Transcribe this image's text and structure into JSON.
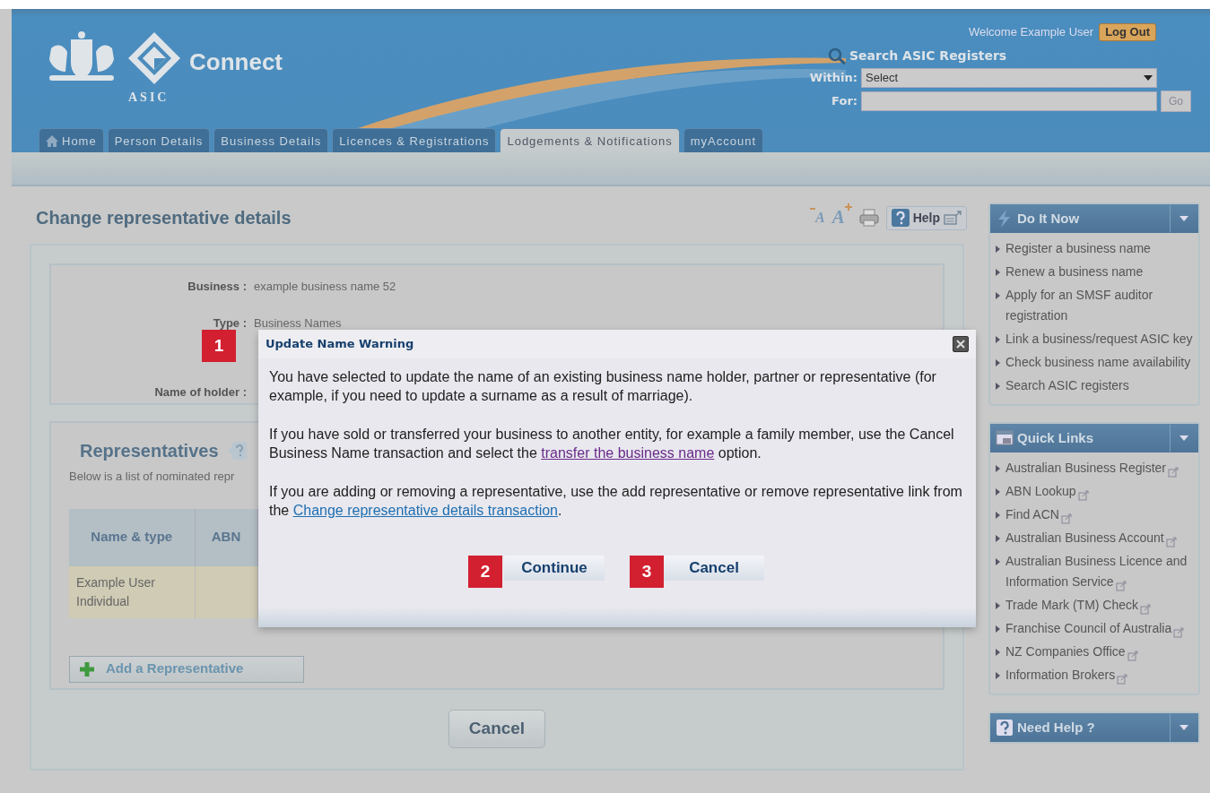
{
  "header": {
    "brand": "Connect",
    "org": "ASIC",
    "welcome": "Welcome Example User",
    "logout": "Log Out",
    "search": {
      "title": "Search ASIC Registers",
      "within_label": "Within:",
      "within_value": "Select",
      "for_label": "For:",
      "go": "Go"
    }
  },
  "tabs": [
    {
      "label": "Home",
      "kind": "home",
      "selected": false
    },
    {
      "label": "Person Details",
      "kind": "text",
      "selected": false
    },
    {
      "label": "Business Details",
      "kind": "text",
      "selected": false
    },
    {
      "label": "Licences & Registrations",
      "kind": "text",
      "selected": false
    },
    {
      "label": "Lodgements & Notifications",
      "kind": "text",
      "selected": true
    },
    {
      "label": "myAccount",
      "kind": "text",
      "selected": false
    }
  ],
  "page_title": "Change representative details",
  "toolbar": {
    "text_size": [
      {
        "label": "A",
        "kind": "decrease"
      },
      {
        "label": "A",
        "kind": "increase"
      }
    ],
    "help": "Help"
  },
  "details": [
    {
      "label": "Business :",
      "value": "example business name 52"
    },
    {
      "label": "Type :",
      "value": "Business Names"
    },
    {
      "label": "Name of holder :"
    }
  ],
  "representatives": {
    "title": "Representatives",
    "intro": "Below is a list of nominated repr",
    "columns": [
      "Name & type",
      "ABN"
    ],
    "rows": [
      {
        "cells": [
          [
            "Example User",
            "Individual"
          ],
          []
        ]
      }
    ],
    "add": "Add a Representative"
  },
  "cancel": "Cancel",
  "sidebar": [
    {
      "title": "Do It Now",
      "kind": "bolt",
      "items": [
        {
          "label": "Register a business name",
          "external": false
        },
        {
          "label": "Renew a business name",
          "external": false
        },
        {
          "label": "Apply for an SMSF auditor registration",
          "external": false
        },
        {
          "label": "Link a business/request ASIC key",
          "external": false
        },
        {
          "label": "Check business name availability",
          "external": false
        },
        {
          "label": "Search ASIC registers",
          "external": false
        }
      ]
    },
    {
      "title": "Quick Links",
      "kind": "links",
      "items": [
        {
          "label": "Australian Business Register",
          "external": true
        },
        {
          "label": "ABN Lookup",
          "external": true
        },
        {
          "label": "Find ACN",
          "external": true
        },
        {
          "label": "Australian Business Account",
          "external": true
        },
        {
          "label": "Australian Business Licence and Information Service",
          "external": true
        },
        {
          "label": "Trade Mark (TM) Check",
          "external": true
        },
        {
          "label": "Franchise Council of Australia",
          "external": true
        },
        {
          "label": "NZ Companies Office",
          "external": true
        },
        {
          "label": "Information Brokers",
          "external": true
        }
      ]
    },
    {
      "title": "Need Help ?",
      "kind": "help"
    }
  ],
  "dialog": {
    "title": "Update Name Warning",
    "paragraphs": [
      [
        {
          "text": "You have selected to update the name of an existing business name holder, partner or representative (for example, if you need to update a surname as a result of marriage)."
        }
      ],
      [
        {
          "text": "If you have sold or transferred your business to another entity, for example a family member, use the Cancel Business Name transaction and select the "
        },
        {
          "link": "transfer the business name",
          "visited": true
        },
        {
          "text": " option."
        }
      ],
      [
        {
          "text": "If you are adding or removing a representative, use the add representative or remove representative link from the "
        },
        {
          "link": "Change representative details transaction",
          "visited": false
        },
        {
          "text": "."
        }
      ]
    ],
    "buttons": [
      "Continue",
      "Cancel"
    ]
  },
  "markers": [
    "1",
    "2",
    "3"
  ]
}
